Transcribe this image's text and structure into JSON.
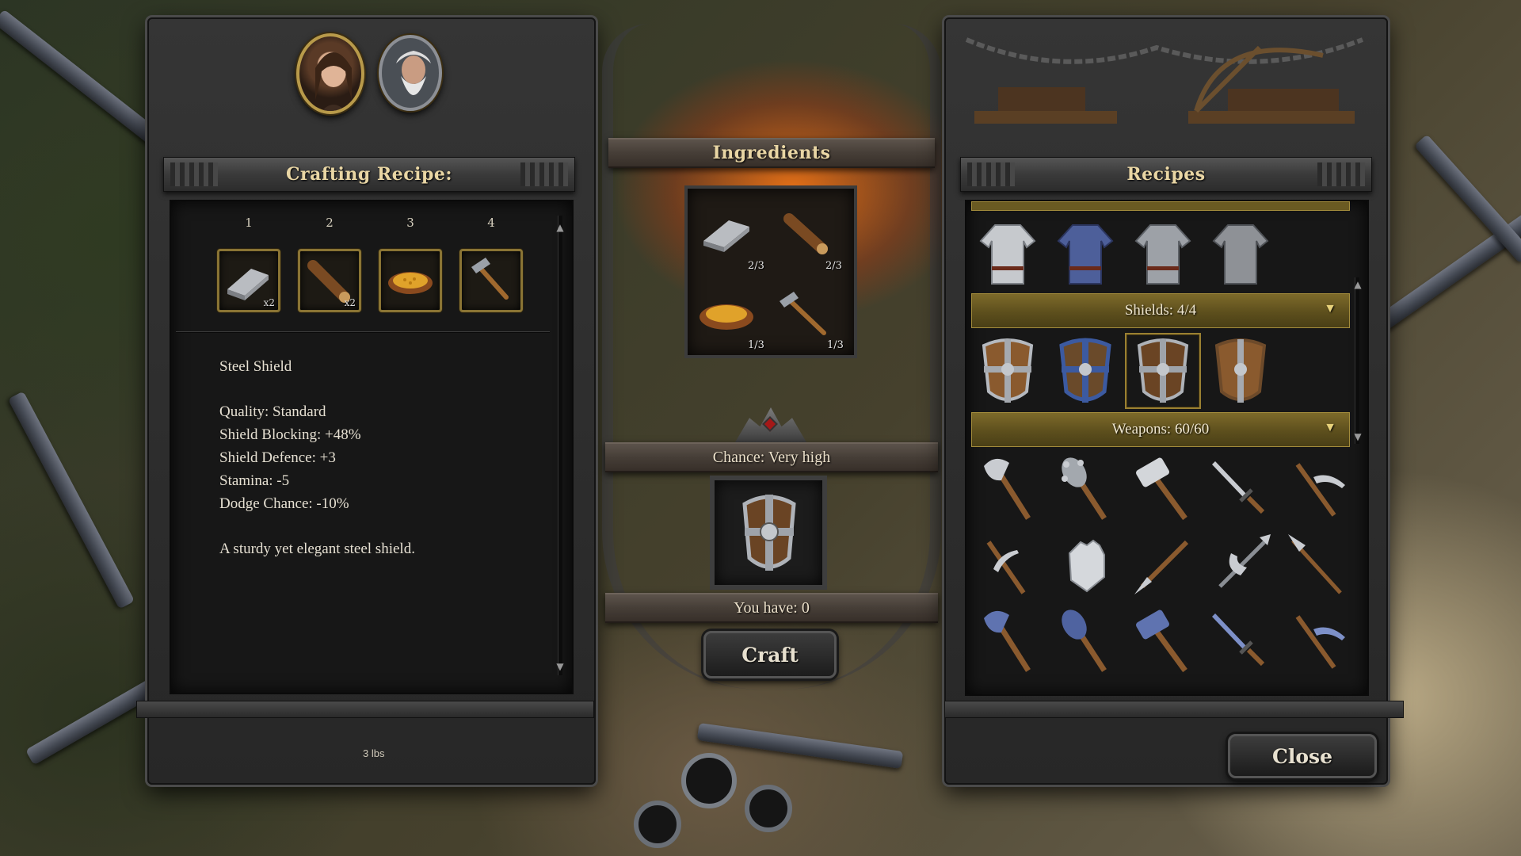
{
  "left_panel": {
    "title": "Crafting Recipe:",
    "avatars": [
      {
        "icon": "woman-portrait-icon"
      },
      {
        "icon": "old-man-portrait-icon"
      }
    ],
    "slots": [
      {
        "number": "1",
        "icon": "steel-ingot-icon",
        "qty": "x2"
      },
      {
        "number": "2",
        "icon": "wood-log-icon",
        "qty": "x2"
      },
      {
        "number": "3",
        "icon": "bowl-of-grain-icon",
        "qty": ""
      },
      {
        "number": "4",
        "icon": "hammer-icon",
        "qty": ""
      }
    ],
    "item_name": "Steel Shield",
    "stats": [
      "Quality: Standard",
      "Shield Blocking: +48%",
      "Shield Defence: +3",
      "Stamina: -5",
      "Dodge Chance: -10%"
    ],
    "description": "A sturdy yet elegant steel shield.",
    "weight": "3 lbs"
  },
  "center_panel": {
    "ingredients_title": "Ingredients",
    "ingredients": [
      {
        "icon": "steel-ingot-icon",
        "count": "2/3"
      },
      {
        "icon": "wood-log-icon",
        "count": "2/3"
      },
      {
        "icon": "bowl-of-grain-icon",
        "count": "1/3"
      },
      {
        "icon": "hammer-icon",
        "count": "1/3"
      }
    ],
    "chance_label": "Chance: Very high",
    "result_icon": "steel-shield-icon",
    "you_have_label": "You have: 0",
    "craft_label": "Craft"
  },
  "right_panel": {
    "title": "Recipes",
    "armor_row": [
      "chainmail-shirt-icon",
      "blue-chainmail-shirt-icon",
      "chainmail-shirt-icon",
      "chainmail-shirt-icon"
    ],
    "shields_label": "Shields:  4/4",
    "shields": [
      "wooden-shield-icon",
      "blue-shield-icon",
      "steel-shield-icon",
      "wooden-shield-icon"
    ],
    "selected_shield_index": 2,
    "weapons_label": "Weapons:  60/60",
    "weapons": [
      "axe-icon",
      "spiked-mace-icon",
      "warhammer-icon",
      "dagger-icon",
      "pickaxe-icon",
      "pickaxe-icon",
      "gauntlet-icon",
      "spear-icon",
      "halberd-icon",
      "spear-icon",
      "axe-icon",
      "spiked-mace-icon",
      "warhammer-icon",
      "dagger-icon",
      "pickaxe-icon"
    ],
    "close_label": "Close"
  },
  "colors": {
    "gold_border": "#8a7434",
    "category_bar": "#6a5a22",
    "panel_bg": "#2e2e2e",
    "inner_bg": "#171717",
    "title_text": "#e9d6a4"
  }
}
